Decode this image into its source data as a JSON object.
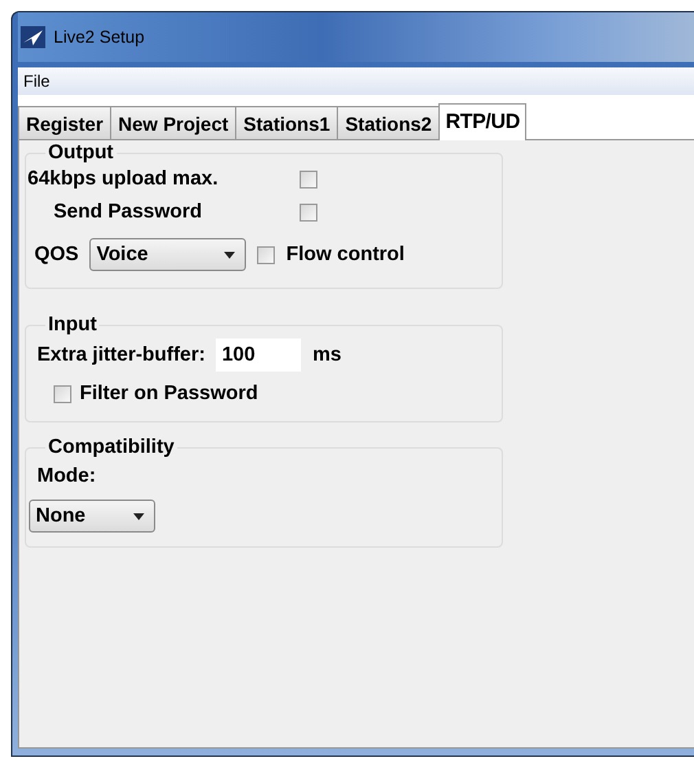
{
  "window": {
    "title": "Live2 Setup"
  },
  "menu": [
    "File"
  ],
  "tabs": [
    {
      "label": "Register",
      "selected": false
    },
    {
      "label": "New Project",
      "selected": false
    },
    {
      "label": "Stations1",
      "selected": false
    },
    {
      "label": "Stations2",
      "selected": false
    },
    {
      "label": "RTP/UD",
      "selected": true
    }
  ],
  "output": {
    "title": "Output",
    "upload_max": {
      "label": "64kbps upload max.",
      "checked": false
    },
    "send_password": {
      "label": "Send Password",
      "checked": false
    },
    "qos": {
      "label": "QOS",
      "value": "Voice"
    },
    "flow_control": {
      "label": "Flow control",
      "checked": false
    }
  },
  "input": {
    "title": "Input",
    "jitter": {
      "label": "Extra jitter-buffer:",
      "value": "100",
      "unit": "ms"
    },
    "filter_password": {
      "label": "Filter on Password",
      "checked": false
    }
  },
  "compatibility": {
    "title": "Compatibility",
    "mode": {
      "label": "Mode:",
      "value": "None"
    }
  }
}
